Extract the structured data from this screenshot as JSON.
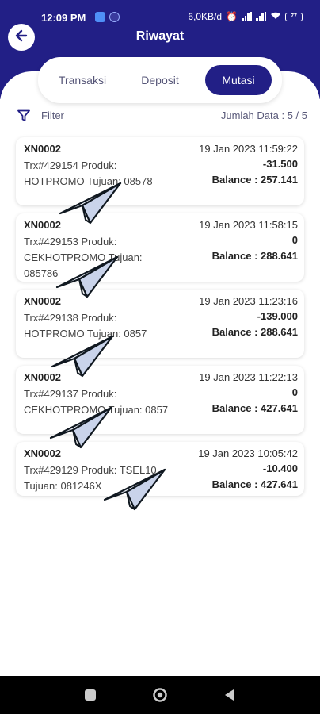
{
  "status_bar": {
    "time": "12:09 PM",
    "speed": "6,0KB/d",
    "battery": "77"
  },
  "header": {
    "title": "Riwayat",
    "background": "#221f86"
  },
  "tabs": [
    {
      "label": "Transaksi",
      "active": false
    },
    {
      "label": "Deposit",
      "active": false
    },
    {
      "label": "Mutasi",
      "active": true
    }
  ],
  "filter": {
    "label": "Filter",
    "count_text": "Jumlah Data : 5 /  5"
  },
  "transactions": [
    {
      "id": "XN0002",
      "date": "19 Jan 2023 11:59:22",
      "desc": "Trx#429154 Produk: HOTPROMO Tujuan: 08578",
      "amount": "-31.500",
      "balance": "Balance : 257.141"
    },
    {
      "id": "XN0002",
      "date": "19 Jan 2023 11:58:15",
      "desc": "Trx#429153 Produk: CEKHOTPROMO Tujuan: 085786",
      "amount": "0",
      "balance": "Balance : 288.641"
    },
    {
      "id": "XN0002",
      "date": "19 Jan 2023 11:23:16",
      "desc": "Trx#429138 Produk: HOTPROMO Tujuan: 0857",
      "amount": "-139.000",
      "balance": "Balance : 288.641"
    },
    {
      "id": "XN0002",
      "date": "19 Jan 2023 11:22:13",
      "desc": "Trx#429137 Produk: CEKHOTPROMO Tujuan: 0857",
      "amount": "0",
      "balance": "Balance : 427.641"
    },
    {
      "id": "XN0002",
      "date": "19 Jan 2023 10:05:42",
      "desc": "Trx#429129 Produk: TSEL10 Tujuan: 081246X",
      "amount": "-10.400",
      "balance": "Balance : 427.641"
    }
  ],
  "icons": {
    "back": "arrow-left-icon",
    "filter": "funnel-icon",
    "overlay": "paper-plane-icon",
    "nav": [
      "square-icon",
      "circle-icon",
      "triangle-back-icon"
    ]
  }
}
